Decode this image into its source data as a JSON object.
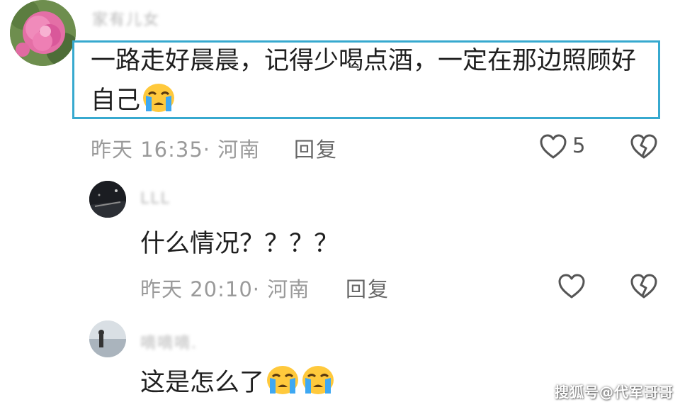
{
  "comments": [
    {
      "author": "家有儿女",
      "text": "一路走好晨晨，记得少喝点酒，一定在那边照顾好自己",
      "emoji": "crying-face",
      "meta": "昨天 16:35· 河南",
      "reply_label": "回复",
      "likes": "5"
    },
    {
      "author": "LLL",
      "text": "什么情况？？？？",
      "meta": "昨天 20:10· 河南",
      "reply_label": "回复"
    },
    {
      "author": "嘀嘀嘀.",
      "text": "这是怎么了",
      "emoji": "crying-face"
    }
  ],
  "watermark": "搜狐号@代军哥哥",
  "colors": {
    "highlight_border": "#37a9cf",
    "emoji_face": "#ffc93c",
    "emoji_tears": "#3ea8f2"
  }
}
